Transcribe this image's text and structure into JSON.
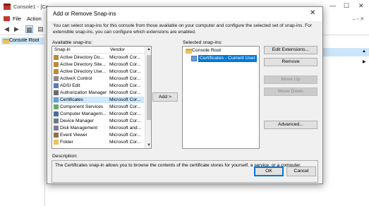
{
  "background": {
    "title": "Console1 - [Co",
    "menu": [
      "File",
      "Action"
    ],
    "tree_item": "Console Root",
    "controls": [
      "—",
      "☐",
      "✕"
    ]
  },
  "dialog": {
    "title": "Add or Remove Snap-ins",
    "intro": "You can select snap-ins for this console from those available on your computer and configure the selected set of snap-ins. For extensible snap-ins, you can configure which extensions are enabled.",
    "available_label": "Available snap-ins:",
    "columns": {
      "snapin": "Snap-in",
      "vendor": "Vendor"
    },
    "snapins": [
      {
        "name": "Active Directory Do...",
        "vendor": "Microsoft Cor...",
        "icon": "directory-icon"
      },
      {
        "name": "Active Directory Site...",
        "vendor": "Microsoft Cor...",
        "icon": "directory-icon"
      },
      {
        "name": "Active Directory Use...",
        "vendor": "Microsoft Cor...",
        "icon": "directory-icon"
      },
      {
        "name": "ActiveX Control",
        "vendor": "Microsoft Cor...",
        "icon": "activex-icon"
      },
      {
        "name": "ADSI Edit",
        "vendor": "Microsoft Cor...",
        "icon": "edit-icon"
      },
      {
        "name": "Authorization Manager",
        "vendor": "Microsoft Cor...",
        "icon": "auth-icon"
      },
      {
        "name": "Certificates",
        "vendor": "Microsoft Cor...",
        "icon": "certificate-icon",
        "selected": true
      },
      {
        "name": "Component Services",
        "vendor": "Microsoft Cor...",
        "icon": "component-icon"
      },
      {
        "name": "Computer Managem...",
        "vendor": "Microsoft Cor...",
        "icon": "computer-icon"
      },
      {
        "name": "Device Manager",
        "vendor": "Microsoft Cor...",
        "icon": "device-icon"
      },
      {
        "name": "Disk Management",
        "vendor": "Microsoft and...",
        "icon": "disk-icon"
      },
      {
        "name": "Event Viewer",
        "vendor": "Microsoft Cor...",
        "icon": "event-icon"
      },
      {
        "name": "Folder",
        "vendor": "Microsoft Cor...",
        "icon": "folder-icon"
      }
    ],
    "add_button": "Add >",
    "selected_label": "Selected snap-ins:",
    "selected_root": "Console Root",
    "selected_child": "Certificates - Current User",
    "side_buttons": {
      "edit_extensions": "Edit Extensions...",
      "remove": "Remove",
      "move_up": "Move Up",
      "move_down": "Move Down",
      "advanced": "Advanced..."
    },
    "description_label": "Description:",
    "description": "The Certificates snap-in allows you to browse the contents of the certificate stores for yourself, a service, or a computer.",
    "ok": "OK",
    "cancel": "Cancel",
    "close_glyph": "✕"
  },
  "colors": {
    "accent": "#0078d7",
    "selection": "#cce8ff",
    "folder": "#e8c25a"
  }
}
